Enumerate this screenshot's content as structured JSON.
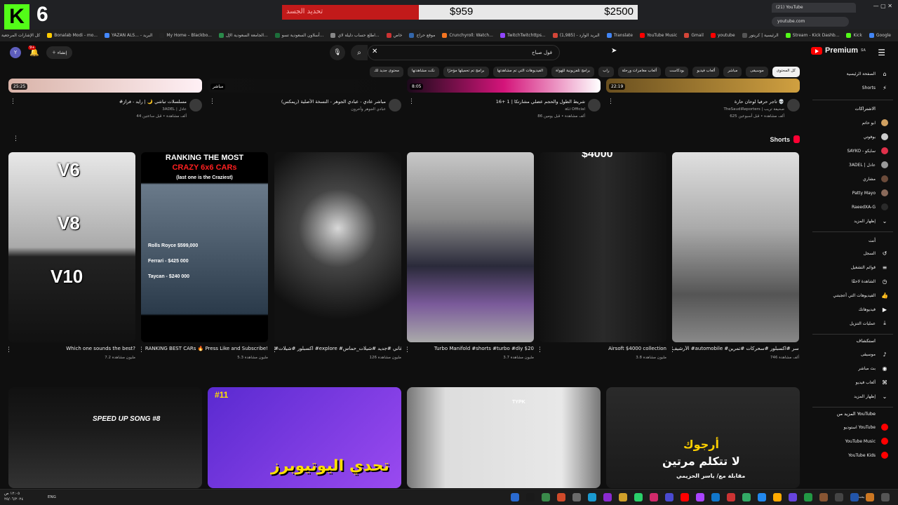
{
  "browser": {
    "overlay_number": "6",
    "tab_title": "(21) YouTube",
    "url": "youtube.com",
    "bookmarks": [
      {
        "label": "كل الإشارات المرجعية",
        "color": "#888"
      },
      {
        "label": "Bonalab Modi - mo...",
        "color": "#ffcc00"
      },
      {
        "label": "YAZAN ALS... - البريد",
        "color": "#4488ff"
      },
      {
        "label": "My Home – Blackbo...",
        "color": "#222222"
      },
      {
        "label": "الجامعة السعودية الإل...",
        "color": "#2a8a4a"
      },
      {
        "label": "أسلاون السعودية تسو...",
        "color": "#1c6e3a"
      },
      {
        "label": "اطلع حساب دليلة لاي...",
        "color": "#888888"
      },
      {
        "label": "خاص",
        "color": "#cc3333"
      },
      {
        "label": "موقع حراج",
        "color": "#3366aa"
      },
      {
        "label": "Crunchyroll: Watch...",
        "color": "#f47521"
      },
      {
        "label": "TwitchTwitchttps...",
        "color": "#9146ff"
      },
      {
        "label": "(1,985) - البريد الوارد",
        "color": "#d44638"
      },
      {
        "label": "Translate",
        "color": "#4285f4"
      },
      {
        "label": "YouTube Music",
        "color": "#ff0000"
      },
      {
        "label": "Gmail",
        "color": "#d44638"
      },
      {
        "label": "youtube",
        "color": "#ff0000"
      },
      {
        "label": "الرئيسية | كريتور",
        "color": "#555555"
      },
      {
        "label": "Stream - Kick Dashb...",
        "color": "#53fc18"
      },
      {
        "label": "Kick",
        "color": "#53fc18"
      },
      {
        "label": "Google",
        "color": "#4285f4"
      }
    ]
  },
  "donation": {
    "label": "تحديد الجسد",
    "current": "$959",
    "goal": "$2500",
    "progress": 0.384
  },
  "youtube": {
    "logo": "Premium",
    "logo_sup": "SA",
    "search_value": "فول صباح",
    "create_label": "إنشاء",
    "notifications": "9+",
    "avatar_letter": "Y",
    "chips": [
      {
        "label": "كل المحتوى",
        "active": true
      },
      {
        "label": "موسيقى",
        "active": false
      },
      {
        "label": "مباشر",
        "active": false
      },
      {
        "label": "ألعاب فيديو",
        "active": false
      },
      {
        "label": "بودكاست",
        "active": false
      },
      {
        "label": "ألعاب مغامرات ورحلة",
        "active": false
      },
      {
        "label": "راب",
        "active": false
      },
      {
        "label": "برامج تلفزيونية للهواة",
        "active": false
      },
      {
        "label": "الفيديوهات التي تم مشاهدتها",
        "active": false
      },
      {
        "label": "برامج تم تحميلها مؤخرًا",
        "active": false
      },
      {
        "label": "نكت مشاهدتها",
        "active": false
      },
      {
        "label": "محتوى جديد لك",
        "active": false
      }
    ],
    "sidebar": {
      "main": [
        {
          "label": "الصفحة الرئيسية",
          "icon": "home-icon",
          "glyph": "⌂"
        },
        {
          "label": "Shorts",
          "icon": "shorts-icon",
          "glyph": "⚡"
        }
      ],
      "subs_title": "الاشتراكات",
      "subs": [
        {
          "label": "ابو حاتم",
          "color": "#d0a060"
        },
        {
          "label": "بوفوتي",
          "color": "#cccccc"
        },
        {
          "label": "SAYKO - سايكو",
          "color": "#e0304a"
        },
        {
          "label": "3ADEL | عادل",
          "color": "#999999"
        },
        {
          "label": "مشاري",
          "color": "#6b4b3a"
        },
        {
          "label": "Patty Mayo",
          "color": "#8a6a5a"
        },
        {
          "label": "RaeedXA-G",
          "color": "#2a2a2a"
        },
        {
          "label": "إظهار المزيد",
          "color": ""
        }
      ],
      "you_title": "أنت",
      "you": [
        {
          "label": "السجل",
          "glyph": "↺"
        },
        {
          "label": "قوائم التشغيل",
          "glyph": "≡"
        },
        {
          "label": "الشاهدة لاحقًا",
          "glyph": "◷"
        },
        {
          "label": "الفيديوهات التي أعجبتني",
          "glyph": "👍"
        },
        {
          "label": "فيديوهاتك",
          "glyph": "▶"
        },
        {
          "label": "عمليات التنزيل",
          "glyph": "⤓"
        }
      ],
      "explore_title": "استكشاف",
      "explore": [
        {
          "label": "موسيقى",
          "glyph": "♪"
        },
        {
          "label": "بث مباشر",
          "glyph": "◉"
        },
        {
          "label": "ألعاب فيديو",
          "glyph": "⌘"
        },
        {
          "label": "إظهار المزيد",
          "glyph": "⌄"
        }
      ],
      "more_title": "المزيد من YouTube",
      "more": [
        {
          "label": "استوديو YouTube",
          "color": "#ff0000"
        },
        {
          "label": "YouTube Music",
          "color": "#ff0000"
        },
        {
          "label": "YouTube Kids",
          "color": "#ff0000"
        }
      ]
    },
    "row1": [
      {
        "title": "تاجر حرفيا لوحان حارة 💀",
        "channel": "TheSaudiReporters | صحيفة تريب",
        "meta": "625 ألف مشاهدة • قبل أسبوعين",
        "duration": "22:19"
      },
      {
        "title": "شريط الطول والحجم عضلي مشارتكا | 1 +16",
        "channel": "aLi Official",
        "meta": "86 ألف مشاهدة • قبل يومين",
        "duration": "8:05"
      },
      {
        "title": "مباشر عادي - عبادي الجوهر - النسخة الأصلية (ريمكس)",
        "channel": "عبادي الجوهر وآخرون",
        "meta": "",
        "duration": "مباشر"
      },
      {
        "title": "#مسلسلات تباشي 🌙 | رايد - فراز",
        "channel": "3ADEL | عادل",
        "meta": "44 ألف مشاهدة • قبل ساعتين",
        "duration": "25:25"
      }
    ],
    "shorts_title": "Shorts",
    "shorts": [
      {
        "title": "Which one sounds the best?",
        "views": "7.2 مليون مشاهدة"
      },
      {
        "title": "RANKING BEST CARs 🔥 Press Like and Subscribe!",
        "views": "5.3 مليون مشاهدة"
      },
      {
        "title": "#اكسبلور #شيلات #explore #ترند #تصميمي #ليك #تصميم #اغاني #جديد #شيلات_حماس #fyp #foryou #x...",
        "views": "126 مليون مشاهدة"
      },
      {
        "title": "Turbo Manifold #shorts #turbo #diy $20",
        "views": "3.7 مليون مشاهدة"
      },
      {
        "title": "Airsoft $4000 collection",
        "views": "3.8 مليون مشاهدة"
      },
      {
        "title": "الأرشيف #automobile #كاسر #اكسبلور #سحركات #تمرين",
        "views": "746 ألف مشاهدة"
      }
    ],
    "short_overlays": {
      "engines": [
        "V6",
        "V8",
        "V10"
      ],
      "ranking_line1": "RANKING THE MOST",
      "ranking_line2": "CRAZY 6x6 CARs",
      "ranking_line3": "(last one is the Craziest)",
      "ranking_list": [
        "Rolls Royce $599,000",
        "Ferrari - $425 000",
        "Taycan - $240 000"
      ],
      "airsoft_price": "$4000"
    },
    "row3": [
      {
        "overlay": "SPEED UP SONG #8"
      },
      {
        "overlay": "تحدي اليوتيوبرز",
        "tag": "#11"
      },
      {
        "overlay": "TYPK"
      },
      {
        "overlay_1": "أرجوك",
        "overlay_2": "لا تتكلم مرتين",
        "overlay_3": "مقابلة مع/ ياسر الحزيمي"
      }
    ]
  },
  "taskbar": {
    "time": "١٢:٠٥ ص",
    "date": "٢٥/٠٦/٢٠٢٤",
    "lang": "ENG",
    "search": "بحث"
  }
}
